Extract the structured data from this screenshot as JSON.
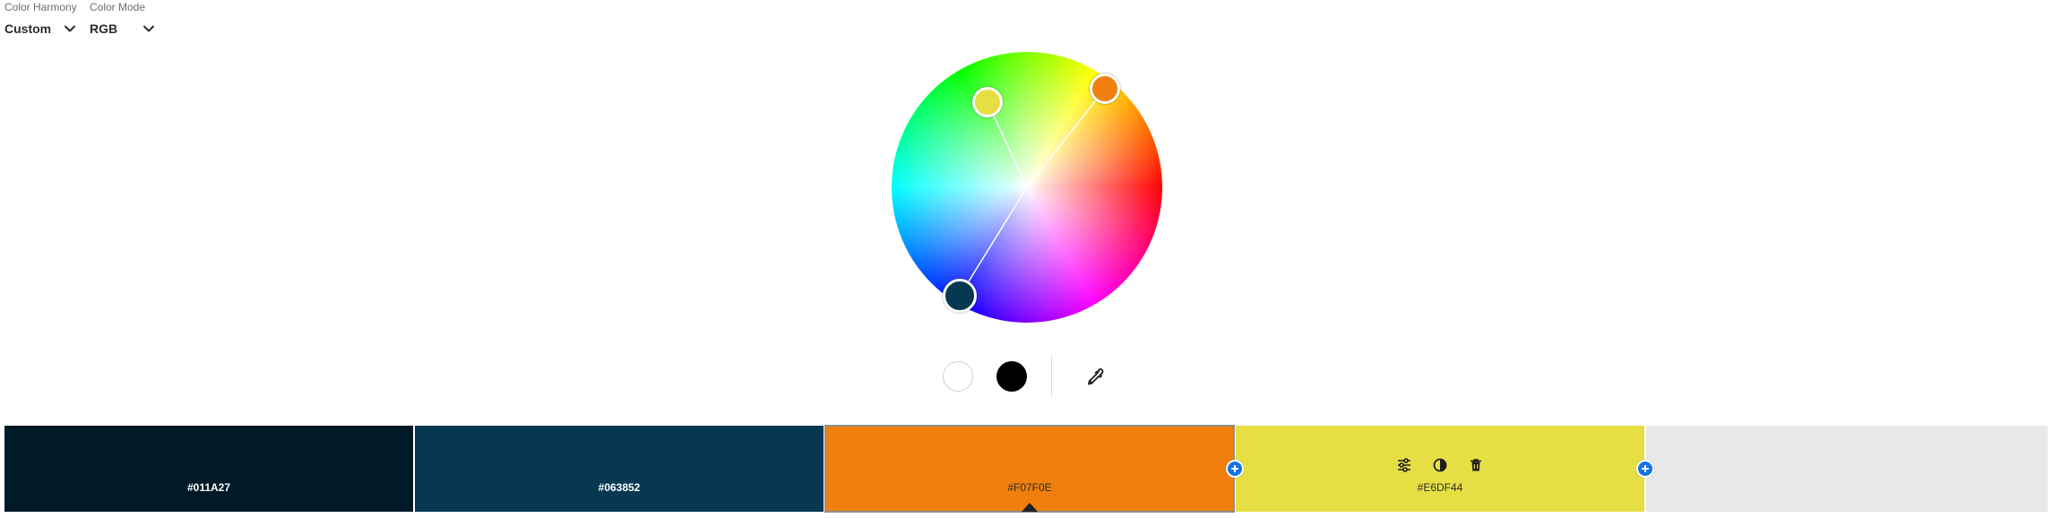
{
  "controls": {
    "harmony": {
      "label": "Color Harmony",
      "value": "Custom",
      "icon": "chevron-down-icon"
    },
    "mode": {
      "label": "Color Mode",
      "value": "RGB",
      "icon": "chevron-down-icon"
    }
  },
  "wheel": {
    "handles": [
      {
        "name": "yellow",
        "color": "#E6DF44"
      },
      {
        "name": "orange",
        "color": "#F07F0E"
      },
      {
        "name": "dark-teal",
        "color": "#063852"
      }
    ]
  },
  "tools": {
    "white_swatch": "#FFFFFF",
    "black_swatch": "#000000",
    "eyedropper_icon": "eyedropper-icon"
  },
  "swatches": [
    {
      "hex": "#011A27",
      "color": "#011A27",
      "text": "light"
    },
    {
      "hex": "#063852",
      "color": "#063852",
      "text": "light"
    },
    {
      "hex": "#F07F0E",
      "color": "#F07F0E",
      "text": "dark",
      "selected": true
    },
    {
      "hex": "#E6DF44",
      "color": "#E6DF44",
      "text": "dark",
      "actions": [
        "sliders-icon",
        "contrast-icon",
        "trash-icon"
      ]
    },
    {
      "hex": "",
      "color": "#E8E8E8",
      "empty": true
    }
  ]
}
